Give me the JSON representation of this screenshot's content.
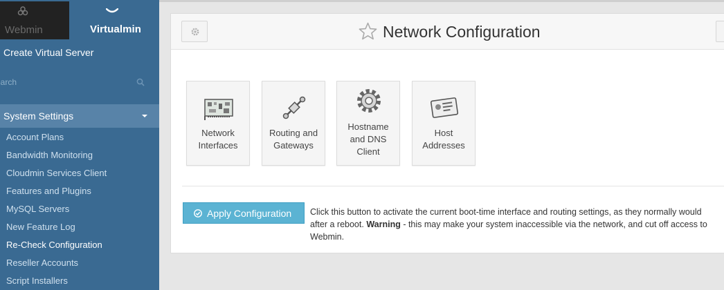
{
  "sidebar": {
    "tabs": {
      "webmin": "Webmin",
      "virtualmin": "Virtualmin"
    },
    "create_virtual_server": "Create Virtual Server",
    "search_placeholder": "Search",
    "section": "System Settings",
    "items": [
      "Account Plans",
      "Bandwidth Monitoring",
      "Cloudmin Services Client",
      "Features and Plugins",
      "MySQL Servers",
      "New Feature Log",
      "Re-Check Configuration",
      "Reseller Accounts",
      "Script Installers"
    ],
    "active_item": "Re-Check Configuration"
  },
  "header": {
    "title": "Network Configuration",
    "icons": {
      "settings": "gear-icon",
      "favorite": "star-icon"
    }
  },
  "tiles": [
    {
      "line1": "Network",
      "line2": "Interfaces",
      "line3": "",
      "icon": "network-card-icon"
    },
    {
      "line1": "Routing and",
      "line2": "Gateways",
      "line3": "",
      "icon": "routing-icon"
    },
    {
      "line1": "Hostname",
      "line2": "and DNS",
      "line3": "Client",
      "icon": "gear-dns-icon"
    },
    {
      "line1": "Host",
      "line2": "Addresses",
      "line3": "",
      "icon": "address-card-icon"
    }
  ],
  "apply": {
    "button_label": "Apply Configuration",
    "desc_line1": "Click this button to activate the current boot-time interface and routing settings, as they normally would",
    "desc_line2_a": "after a reboot. ",
    "desc_warning": "Warning",
    "desc_line2_b": " - this may make your system inaccessible via the network, and cut off access to",
    "desc_line3": "Webmin."
  },
  "colors": {
    "sidebar_bg": "#3a6a92",
    "section_bg": "#5883a8",
    "webmin_tab_bg": "#222222",
    "apply_button_bg": "#5bb3d3",
    "page_bg": "#e6e6e6"
  }
}
